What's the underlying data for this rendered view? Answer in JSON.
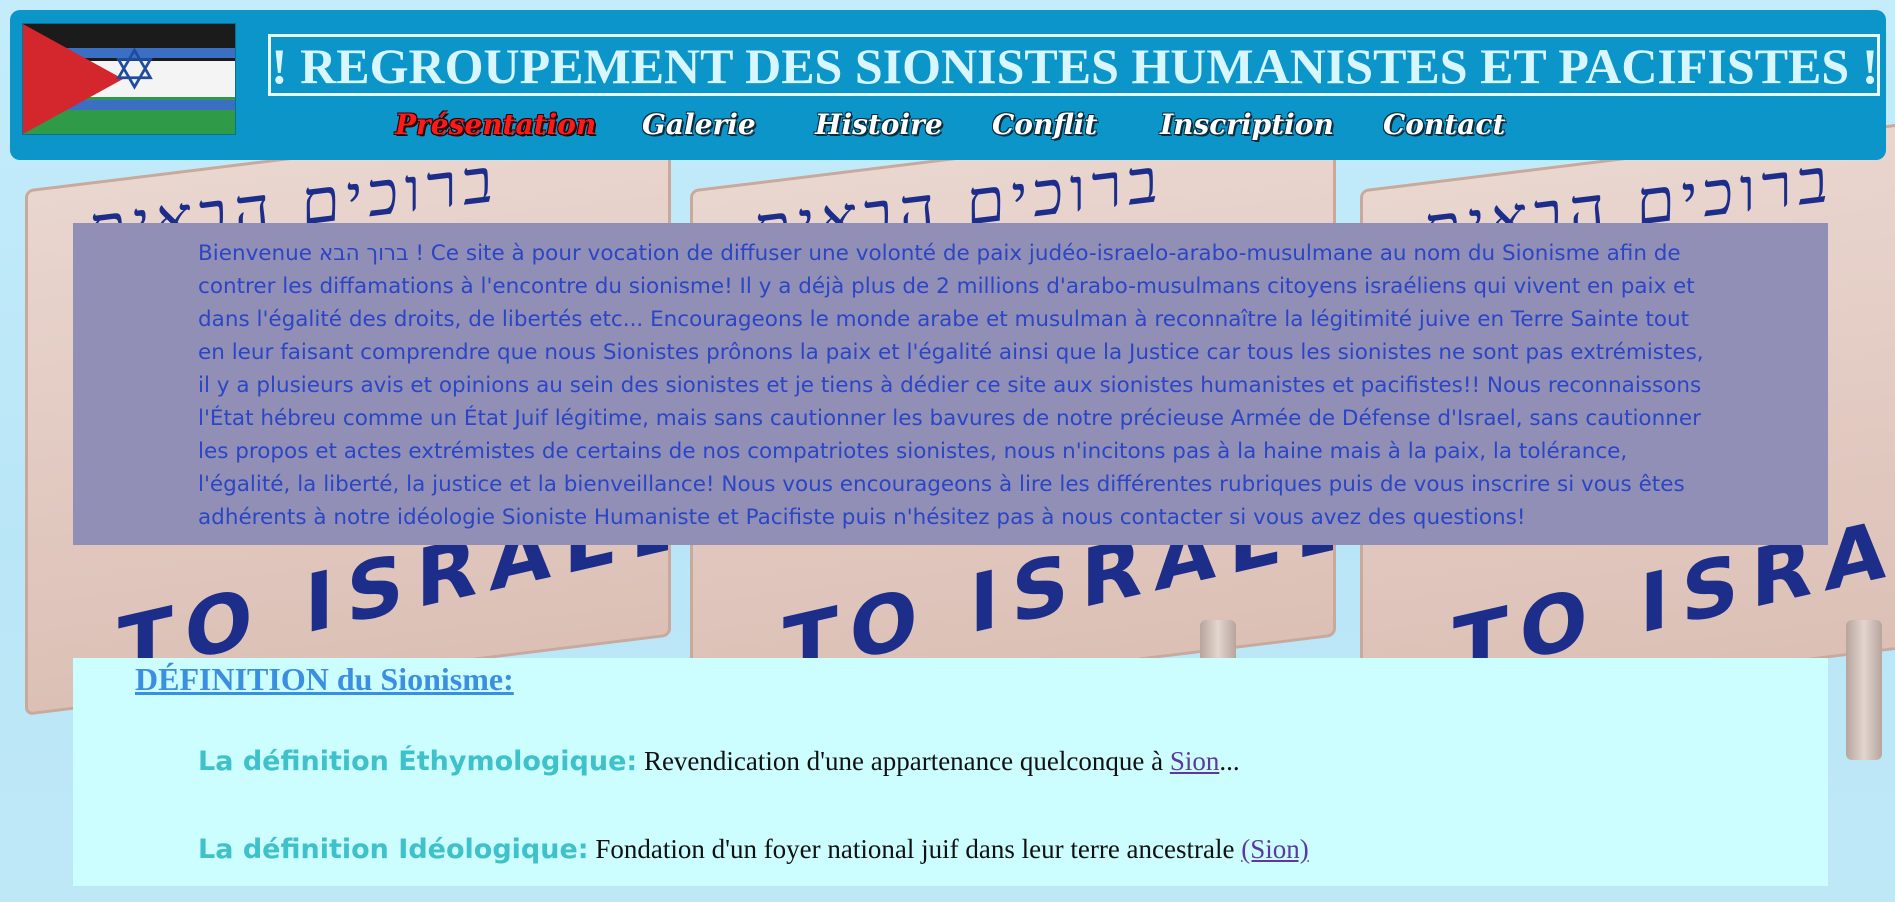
{
  "header": {
    "title": "! REGROUPEMENT DES SIONISTES HUMANISTES ET PACIFISTES !",
    "logo_icon": "israel-palestine-flag-icon"
  },
  "nav": {
    "items": [
      {
        "label": "Présentation",
        "active": true
      },
      {
        "label": "Galerie",
        "active": false
      },
      {
        "label": "Histoire",
        "active": false
      },
      {
        "label": "Conflit",
        "active": false
      },
      {
        "label": "Inscription",
        "active": false
      },
      {
        "label": "Contact",
        "active": false
      }
    ],
    "active_color": "#ff1a1a",
    "item_color": "#ffffff"
  },
  "background": {
    "sign_hebrew": "ברוכים הבאים",
    "sign_text": "TO ISRAEL"
  },
  "intro": {
    "text": "Bienvenue ברוך הבא ! Ce site à pour vocation de diffuser une volonté de paix judéo-israelo-arabo-musulmane au nom du Sionisme afin de contrer les diffamations à l'encontre du sionisme! Il y a déjà plus de 2 millions d'arabo-musulmans citoyens israéliens qui vivent en paix et dans l'égalité des droits, de libertés etc... Encourageons le monde arabe et musulman à reconnaître la légitimité juive en Terre Sainte tout en leur faisant comprendre que nous Sionistes prônons la paix et l'égalité ainsi que la Justice car tous les sionistes ne sont pas extrémistes, il y a plusieurs avis et opinions au sein des sionistes et je tiens à dédier ce site aux sionistes humanistes et pacifistes!! Nous reconnaissons l'État hébreu comme un État Juif légitime, mais sans cautionner les bavures de notre précieuse Armée de Défense d'Israel, sans cautionner les propos et actes extrémistes de certains de nos compatriotes sionistes, nous n'incitons pas à la haine mais à la paix, la tolérance, l'égalité, la liberté, la justice et la bienveillance! Nous vous encourageons à lire les différentes rubriques puis de vous inscrire si vous êtes adhérents à notre idéologie Sioniste Humaniste et Pacifiste puis n'hésitez pas à nous contacter si vous avez des questions!"
  },
  "definition": {
    "heading": "DÉFINITION du Sionisme:",
    "items": [
      {
        "label": "La définition Éthymologique:",
        "text": " Revendication d'une appartenance quelconque à ",
        "link": "Sion",
        "suffix": "..."
      },
      {
        "label": "La définition Idéologique:",
        "text": " Fondation d'un foyer national juif dans leur terre ancestrale ",
        "link": "(Sion)",
        "suffix": ""
      }
    ]
  }
}
